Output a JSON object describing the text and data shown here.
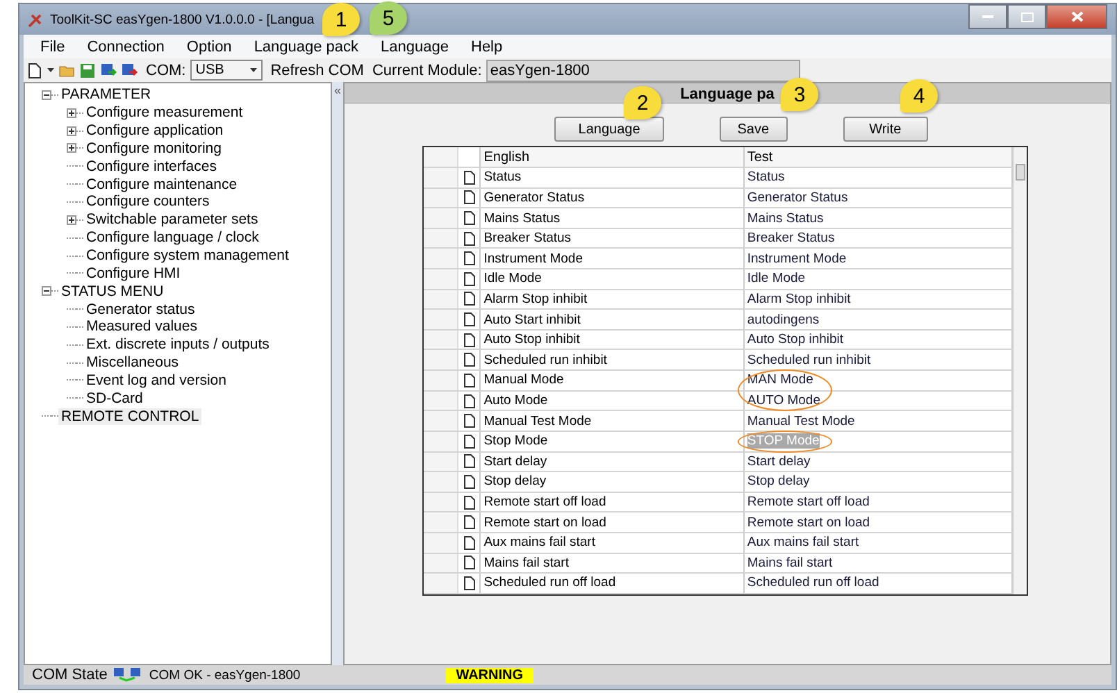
{
  "window": {
    "title": "ToolKit-SC easYgen-1800  V1.0.0.0 - [Langua"
  },
  "menu": [
    "File",
    "Connection",
    "Option",
    "Language pack",
    "Language",
    "Help"
  ],
  "toolbar": {
    "com_label": "COM:",
    "com_value": "USB",
    "refresh": "Refresh COM",
    "module_label": "Current Module:",
    "module_value": "easYgen-1800"
  },
  "tree": [
    {
      "label": "PARAMETER",
      "expanded": true,
      "selected": false,
      "children": [
        {
          "label": "Configure measurement",
          "expanded": false,
          "selected": false
        },
        {
          "label": "Configure application",
          "expanded": false,
          "selected": false
        },
        {
          "label": "Configure monitoring",
          "expanded": false,
          "selected": false
        },
        {
          "label": "Configure interfaces",
          "selected": false
        },
        {
          "label": "Configure maintenance",
          "selected": false
        },
        {
          "label": "Configure counters",
          "selected": false
        },
        {
          "label": "Switchable parameter sets",
          "expanded": false,
          "selected": false
        },
        {
          "label": "Configure language / clock",
          "selected": false
        },
        {
          "label": "Configure system management",
          "selected": false
        },
        {
          "label": "Configure HMI",
          "selected": false
        }
      ]
    },
    {
      "label": "STATUS MENU",
      "expanded": true,
      "selected": false,
      "children": [
        {
          "label": "Generator status",
          "selected": false
        },
        {
          "label": "Measured values",
          "selected": false
        },
        {
          "label": "Ext. discrete inputs / outputs",
          "selected": false
        },
        {
          "label": "Miscellaneous",
          "selected": false
        },
        {
          "label": "Event log and version",
          "selected": false
        },
        {
          "label": "SD-Card",
          "selected": false
        }
      ]
    },
    {
      "label": "REMOTE CONTROL",
      "selected": true
    }
  ],
  "collapse_handle": "«",
  "panel": {
    "title": "Language pa",
    "buttons": [
      "Language",
      "Save",
      "Write"
    ]
  },
  "table": {
    "columns": [
      "English",
      "Test"
    ],
    "rows": [
      {
        "english": "Status",
        "test": "Status",
        "selected": false,
        "circled": false
      },
      {
        "english": "Generator Status",
        "test": "Generator Status",
        "selected": false,
        "circled": false
      },
      {
        "english": "Mains Status",
        "test": "Mains Status",
        "selected": false,
        "circled": false
      },
      {
        "english": "Breaker Status",
        "test": "Breaker Status",
        "selected": false,
        "circled": false
      },
      {
        "english": "Instrument Mode",
        "test": "Instrument Mode",
        "selected": false,
        "circled": false
      },
      {
        "english": "Idle Mode",
        "test": "Idle Mode",
        "selected": false,
        "circled": false
      },
      {
        "english": "Alarm Stop inhibit",
        "test": "Alarm Stop inhibit",
        "selected": false,
        "circled": false
      },
      {
        "english": "Auto Start inhibit",
        "test": "autodingens",
        "selected": false,
        "circled": false
      },
      {
        "english": "Auto Stop inhibit",
        "test": "Auto Stop inhibit",
        "selected": false,
        "circled": false
      },
      {
        "english": "Scheduled run inhibit",
        "test": "Scheduled run inhibit",
        "selected": false,
        "circled": false
      },
      {
        "english": "Manual Mode",
        "test": "MAN Mode",
        "selected": false,
        "circled": true
      },
      {
        "english": "Auto Mode",
        "test": "AUTO Mode",
        "selected": false,
        "circled": true
      },
      {
        "english": "Manual Test Mode",
        "test": "Manual Test Mode",
        "selected": false,
        "circled": false
      },
      {
        "english": "Stop Mode",
        "test": "STOP Mode",
        "selected": true,
        "circled": true
      },
      {
        "english": "Start delay",
        "test": "Start delay",
        "selected": false,
        "circled": false
      },
      {
        "english": "Stop delay",
        "test": "Stop delay",
        "selected": false,
        "circled": false
      },
      {
        "english": "Remote start off load",
        "test": "Remote start off load",
        "selected": false,
        "circled": false
      },
      {
        "english": "Remote start on load",
        "test": "Remote start on load",
        "selected": false,
        "circled": false
      },
      {
        "english": "Aux mains fail start",
        "test": "Aux mains fail start",
        "selected": false,
        "circled": false
      },
      {
        "english": "Mains fail start",
        "test": "Mains fail start",
        "selected": false,
        "circled": false
      },
      {
        "english": "Scheduled run off load",
        "test": "Scheduled run off load",
        "selected": false,
        "circled": false
      }
    ]
  },
  "status_bar": {
    "label": "COM State",
    "connection": "COM OK - easYgen-1800",
    "warning": "WARNING"
  },
  "callouts": [
    {
      "number": "1",
      "color": "#f7dc3c"
    },
    {
      "number": "5",
      "color": "#a6d36a"
    },
    {
      "number": "2",
      "color": "#f7dc3c"
    },
    {
      "number": "3",
      "color": "#f7dc3c"
    },
    {
      "number": "4",
      "color": "#f7dc3c"
    }
  ]
}
